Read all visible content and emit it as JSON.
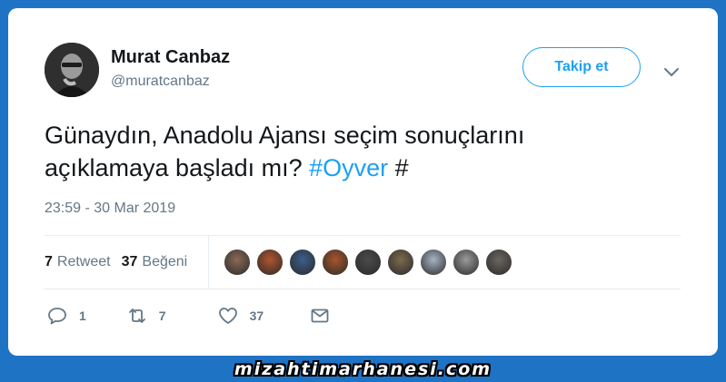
{
  "user": {
    "name": "Murat Canbaz",
    "handle": "@muratcanbaz",
    "avatar_icon": "profile-photo"
  },
  "header": {
    "follow_label": "Takip et",
    "menu_icon": "chevron-down-icon"
  },
  "tweet": {
    "text_line1": "Günaydın, Anadolu Ajansı seçim sonuçlarını",
    "text_line2_prefix": "açıklamaya başladı mı? ",
    "hashtag": "#Oyver",
    "text_suffix": " #",
    "timestamp": "23:59 - 30 Mar 2019"
  },
  "stats": {
    "retweet_count": "7",
    "retweet_label": "Retweet",
    "like_count": "37",
    "like_label": "Beğeni"
  },
  "likers": [
    {
      "color": "#8a6a55"
    },
    {
      "color": "#b0552e"
    },
    {
      "color": "#3d5d8a"
    },
    {
      "color": "#a8552b"
    },
    {
      "color": "#4b4b4b"
    },
    {
      "color": "#7b6a4e"
    },
    {
      "color": "#a7b3c4"
    },
    {
      "color": "#9a9a9a"
    },
    {
      "color": "#6b655e"
    }
  ],
  "actions": {
    "reply_count": "1",
    "retweet_count": "7",
    "like_count": "37"
  },
  "footer": {
    "watermark": "mizahtimarhanesi.com"
  },
  "colors": {
    "background": "#1f73c4",
    "accent": "#1da1f2",
    "text": "#14171a",
    "muted": "#657786"
  }
}
